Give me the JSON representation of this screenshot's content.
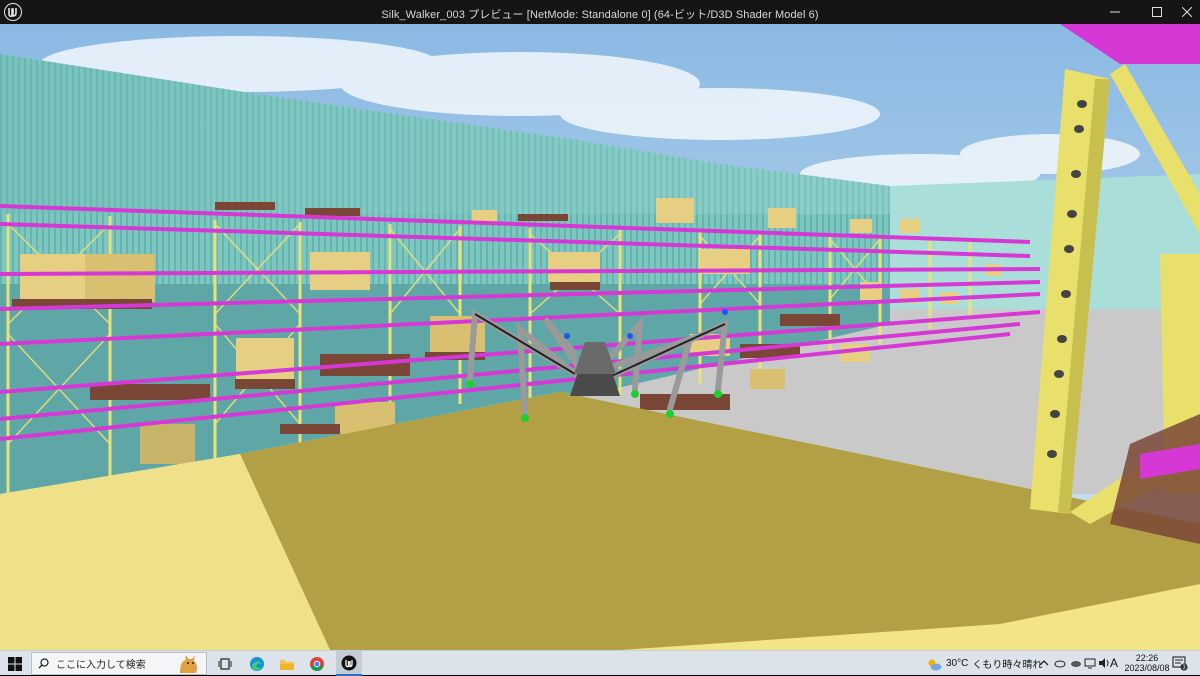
{
  "window": {
    "title": "Silk_Walker_003 プレビュー [NetMode: Standalone 0]  (64-ビット/D3D Shader Model 6)",
    "app_icon": "unreal-engine-logo",
    "controls": [
      "minimize-icon",
      "maximize-icon",
      "close-icon"
    ]
  },
  "viewport": {
    "scene": "warehouse-rack-scene",
    "colors": {
      "sky": "#a9cce9",
      "wall": "#7cc8c0",
      "floor": "#c8c8c8",
      "platform_lit": "#f2e487",
      "platform_shadow": "#b39f45",
      "rack_beam": "#d638d6",
      "rack_post": "#e8e27a",
      "box": "#e6cf82",
      "pallet": "#7a4636",
      "column": "#e8e06a",
      "robot_body": "#555555",
      "leg_tip": "#22cc33"
    }
  },
  "taskbar": {
    "search_placeholder": "ここに入力して検索",
    "apps": [
      {
        "name": "task-view",
        "icon": "task-view-icon"
      },
      {
        "name": "edge",
        "icon": "edge-icon"
      },
      {
        "name": "explorer",
        "icon": "folder-icon"
      },
      {
        "name": "chrome",
        "icon": "chrome-icon"
      },
      {
        "name": "unreal-editor",
        "icon": "unreal-icon",
        "active": true
      }
    ],
    "weather": {
      "temp": "30°C",
      "condition": "くもり時々晴れ"
    },
    "ime": "A",
    "clock": {
      "time": "22:26",
      "date": "2023/08/08"
    },
    "notification_count": "3"
  }
}
